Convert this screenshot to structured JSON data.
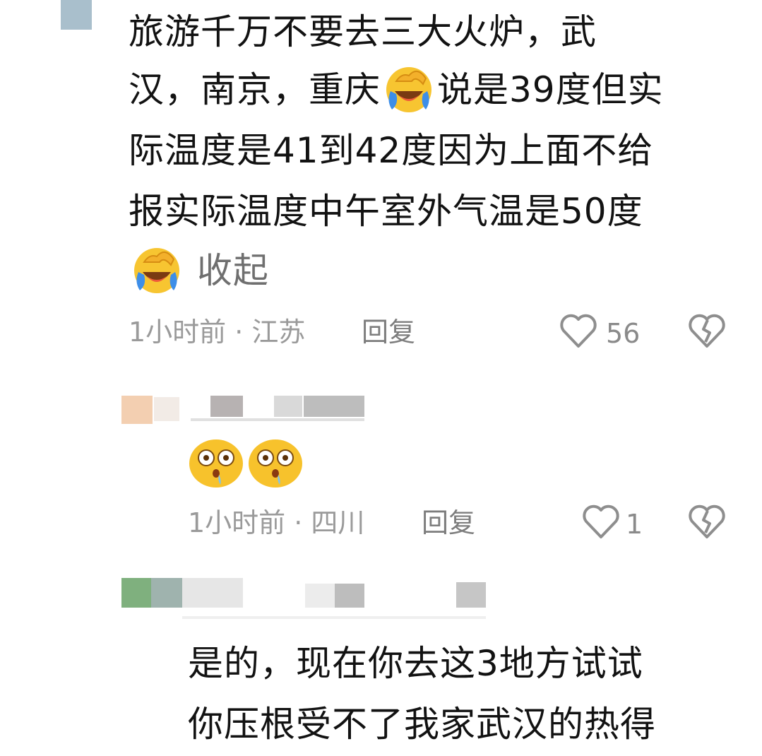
{
  "comment1": {
    "line1": "旅游千万不要去三大火炉，武",
    "line2_a": "汉，南京，重庆",
    "line2_b": "说是39度但实",
    "line3": "际温度是41到42度因为上面不给",
    "line4": "报实际温度中午室外气温是50度",
    "collapse": "收起",
    "meta": "1小时前 · 江苏",
    "reply": "回复",
    "likes": "56"
  },
  "comment2": {
    "meta": "1小时前 · 四川",
    "reply": "回复",
    "likes": "1"
  },
  "comment3": {
    "line1": "是的，现在你去这3地方试试",
    "line2": "你压根受不了我家武汉的热得"
  },
  "icons": {
    "like": "heart-outline-icon",
    "dislike": "broken-heart-icon",
    "laugh_cry": "face-with-tears-of-joy-emoji",
    "shocked_drool": "shocked-drool-emoji"
  }
}
